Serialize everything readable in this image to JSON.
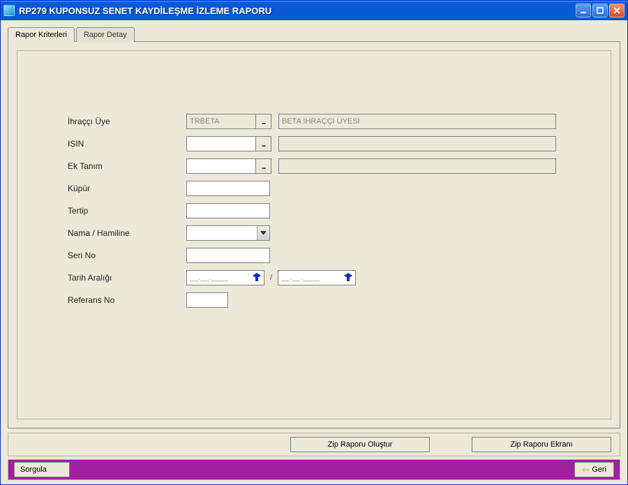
{
  "window": {
    "title": "RP279 KUPONSUZ SENET KAYDİLEŞME İZLEME RAPORU"
  },
  "tabs": {
    "criteria": "Rapor Kriterleri",
    "detail": "Rapor Detay"
  },
  "labels": {
    "ihracci": "İhraççı Üye",
    "isin": "ISIN",
    "ektanim": "Ek Tanım",
    "kupur": "Küpür",
    "tertip": "Tertip",
    "nama": "Nama / Hamiline",
    "serino": "Seri No",
    "tarih": "Tarih Aralığı",
    "referans": "Referans No"
  },
  "fields": {
    "ihracci_code": "TRBETA",
    "ihracci_desc": "BETA İHRAÇÇI ÜYESİ",
    "isin_code": "",
    "isin_desc": "",
    "ektanim_code": "",
    "ektanim_desc": "",
    "kupur": "",
    "tertip": "",
    "nama_selected": "",
    "serino": "",
    "date_from": "__.__.____",
    "date_to": "__.__.____",
    "date_sep": "/",
    "referans": ""
  },
  "lookup_label": "...",
  "buttons": {
    "zip_create": "Zip Raporu Oluştur",
    "zip_screen": "Zip Raporu Ekranı",
    "sorgula": "Sorgula",
    "geri": "Geri"
  }
}
